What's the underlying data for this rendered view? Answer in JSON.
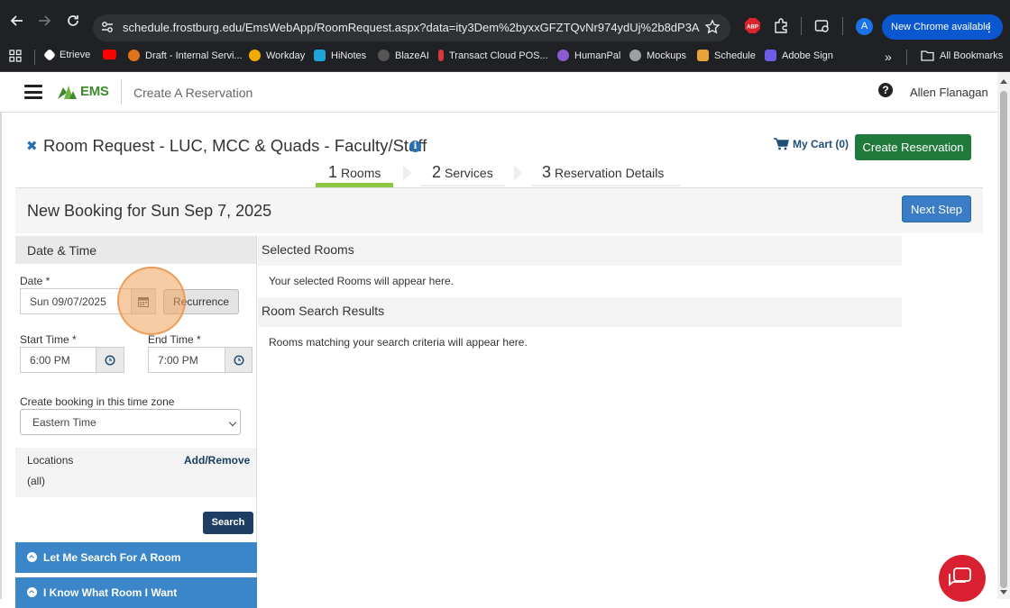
{
  "browser": {
    "url": "schedule.frostburg.edu/EmsWebApp/RoomRequest.aspx?data=ity3Dem%2byxxGFZTQvNr974ydUj%2b8dP3A",
    "profile_initial": "A",
    "update_label": "New Chrome available",
    "abp_label": "ABP",
    "bookmarks": [
      {
        "label": "Etrieve",
        "color": "#ffffff"
      },
      {
        "label": "",
        "color": "#ff0000"
      },
      {
        "label": "Draft - Internal Servi...",
        "color": "#e0741c"
      },
      {
        "label": "Workday",
        "color": "#f2a900"
      },
      {
        "label": "HiNotes",
        "color": "#1fa3d8"
      },
      {
        "label": "BlazeAI",
        "color": "#333333"
      },
      {
        "label": "Transact Cloud POS...",
        "color": "#d9363e"
      },
      {
        "label": "HumanPal",
        "color": "#8a5cd0"
      },
      {
        "label": "Mockups",
        "color": "#9aa0a6"
      },
      {
        "label": "Schedule",
        "color": "#e8a33a"
      },
      {
        "label": "Adobe Sign",
        "color": "#6e5ce8"
      }
    ],
    "all_bookmarks": "All Bookmarks"
  },
  "header": {
    "logo_text": "EMS",
    "context": "Create A Reservation",
    "user": "Allen Flanagan"
  },
  "page": {
    "title": "Room Request - LUC, MCC & Quads - Faculty/Staff",
    "cart": "My Cart (0)",
    "create_button": "Create Reservation",
    "steps": [
      {
        "num": "1",
        "label": "Rooms"
      },
      {
        "num": "2",
        "label": "Services"
      },
      {
        "num": "3",
        "label": "Reservation Details"
      }
    ],
    "booking_title": "New Booking for Sun Sep 7, 2025",
    "next_button": "Next Step",
    "accent_green": "#8dc63f"
  },
  "datetime": {
    "heading": "Date & Time",
    "date_label": "Date *",
    "date_value": "Sun 09/07/2025",
    "recurrence_button": "Recurrence",
    "start_label": "Start Time *",
    "start_value": "6:00 PM",
    "end_label": "End Time *",
    "end_value": "7:00 PM",
    "timezone_label": "Create booking in this time zone",
    "timezone_value": "Eastern Time",
    "locations_label": "Locations",
    "locations_link": "Add/Remove",
    "locations_value": "(all)",
    "search_button": "Search"
  },
  "accordions": [
    {
      "label": "Let Me Search For A Room"
    },
    {
      "label": "I Know What Room I Want"
    }
  ],
  "results": {
    "selected_heading": "Selected Rooms",
    "selected_text": "Your selected Rooms will appear here.",
    "search_heading": "Room Search Results",
    "search_text": "Rooms matching your search criteria will appear here."
  }
}
